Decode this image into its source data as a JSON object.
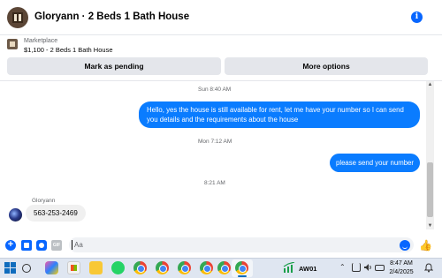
{
  "header": {
    "title": "Gloryann · 2 Beds 1 Bath House",
    "info_icon": "i"
  },
  "marketplace": {
    "label": "Marketplace",
    "item": "$1,100 - 2 Beds 1 Bath House",
    "pending_button": "Mark as pending",
    "more_button": "More options"
  },
  "messages": [
    {
      "timestamp": "Sun 8:40 AM"
    },
    {
      "sender": "me",
      "text": "Hello, yes the house is still available for rent, let me have your number so I can send you details and the requirements about the house"
    },
    {
      "timestamp": "Mon 7:12 AM"
    },
    {
      "sender": "me",
      "text": "please send your number"
    },
    {
      "timestamp": "8:21 AM"
    },
    {
      "sender": "Gloryann",
      "text": "563-253-2469"
    }
  ],
  "composer": {
    "placeholder": "Aa"
  },
  "taskbar": {
    "stock_label": "AW01",
    "time": "8:47 AM",
    "date": "2/4/2025"
  },
  "colors": {
    "accent": "#0866ff",
    "outgoing_bubble": "#0a7cff",
    "incoming_bubble": "#f0f0f0"
  }
}
